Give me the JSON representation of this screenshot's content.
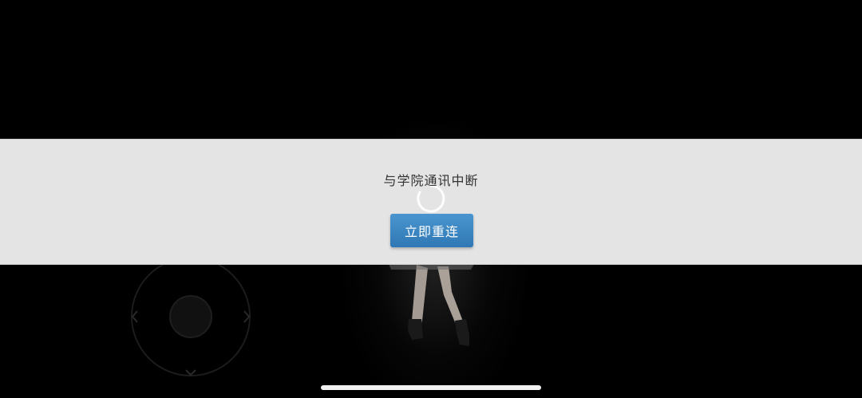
{
  "dialog": {
    "message": "与学院通讯中断",
    "reconnect_label": "立即重连"
  },
  "scene": {
    "joystick_center_label": ""
  },
  "colors": {
    "background": "#000000",
    "dialog_band": "#e4e4e4",
    "button": "#3a86c3",
    "button_text": "#ffffff",
    "message_text": "#333333"
  },
  "icons": {
    "spinner": "loading-spinner-icon",
    "joystick_left": "chevron-left-icon",
    "joystick_right": "chevron-right-icon",
    "joystick_down": "chevron-down-icon",
    "home_indicator": "home-indicator-bar"
  }
}
